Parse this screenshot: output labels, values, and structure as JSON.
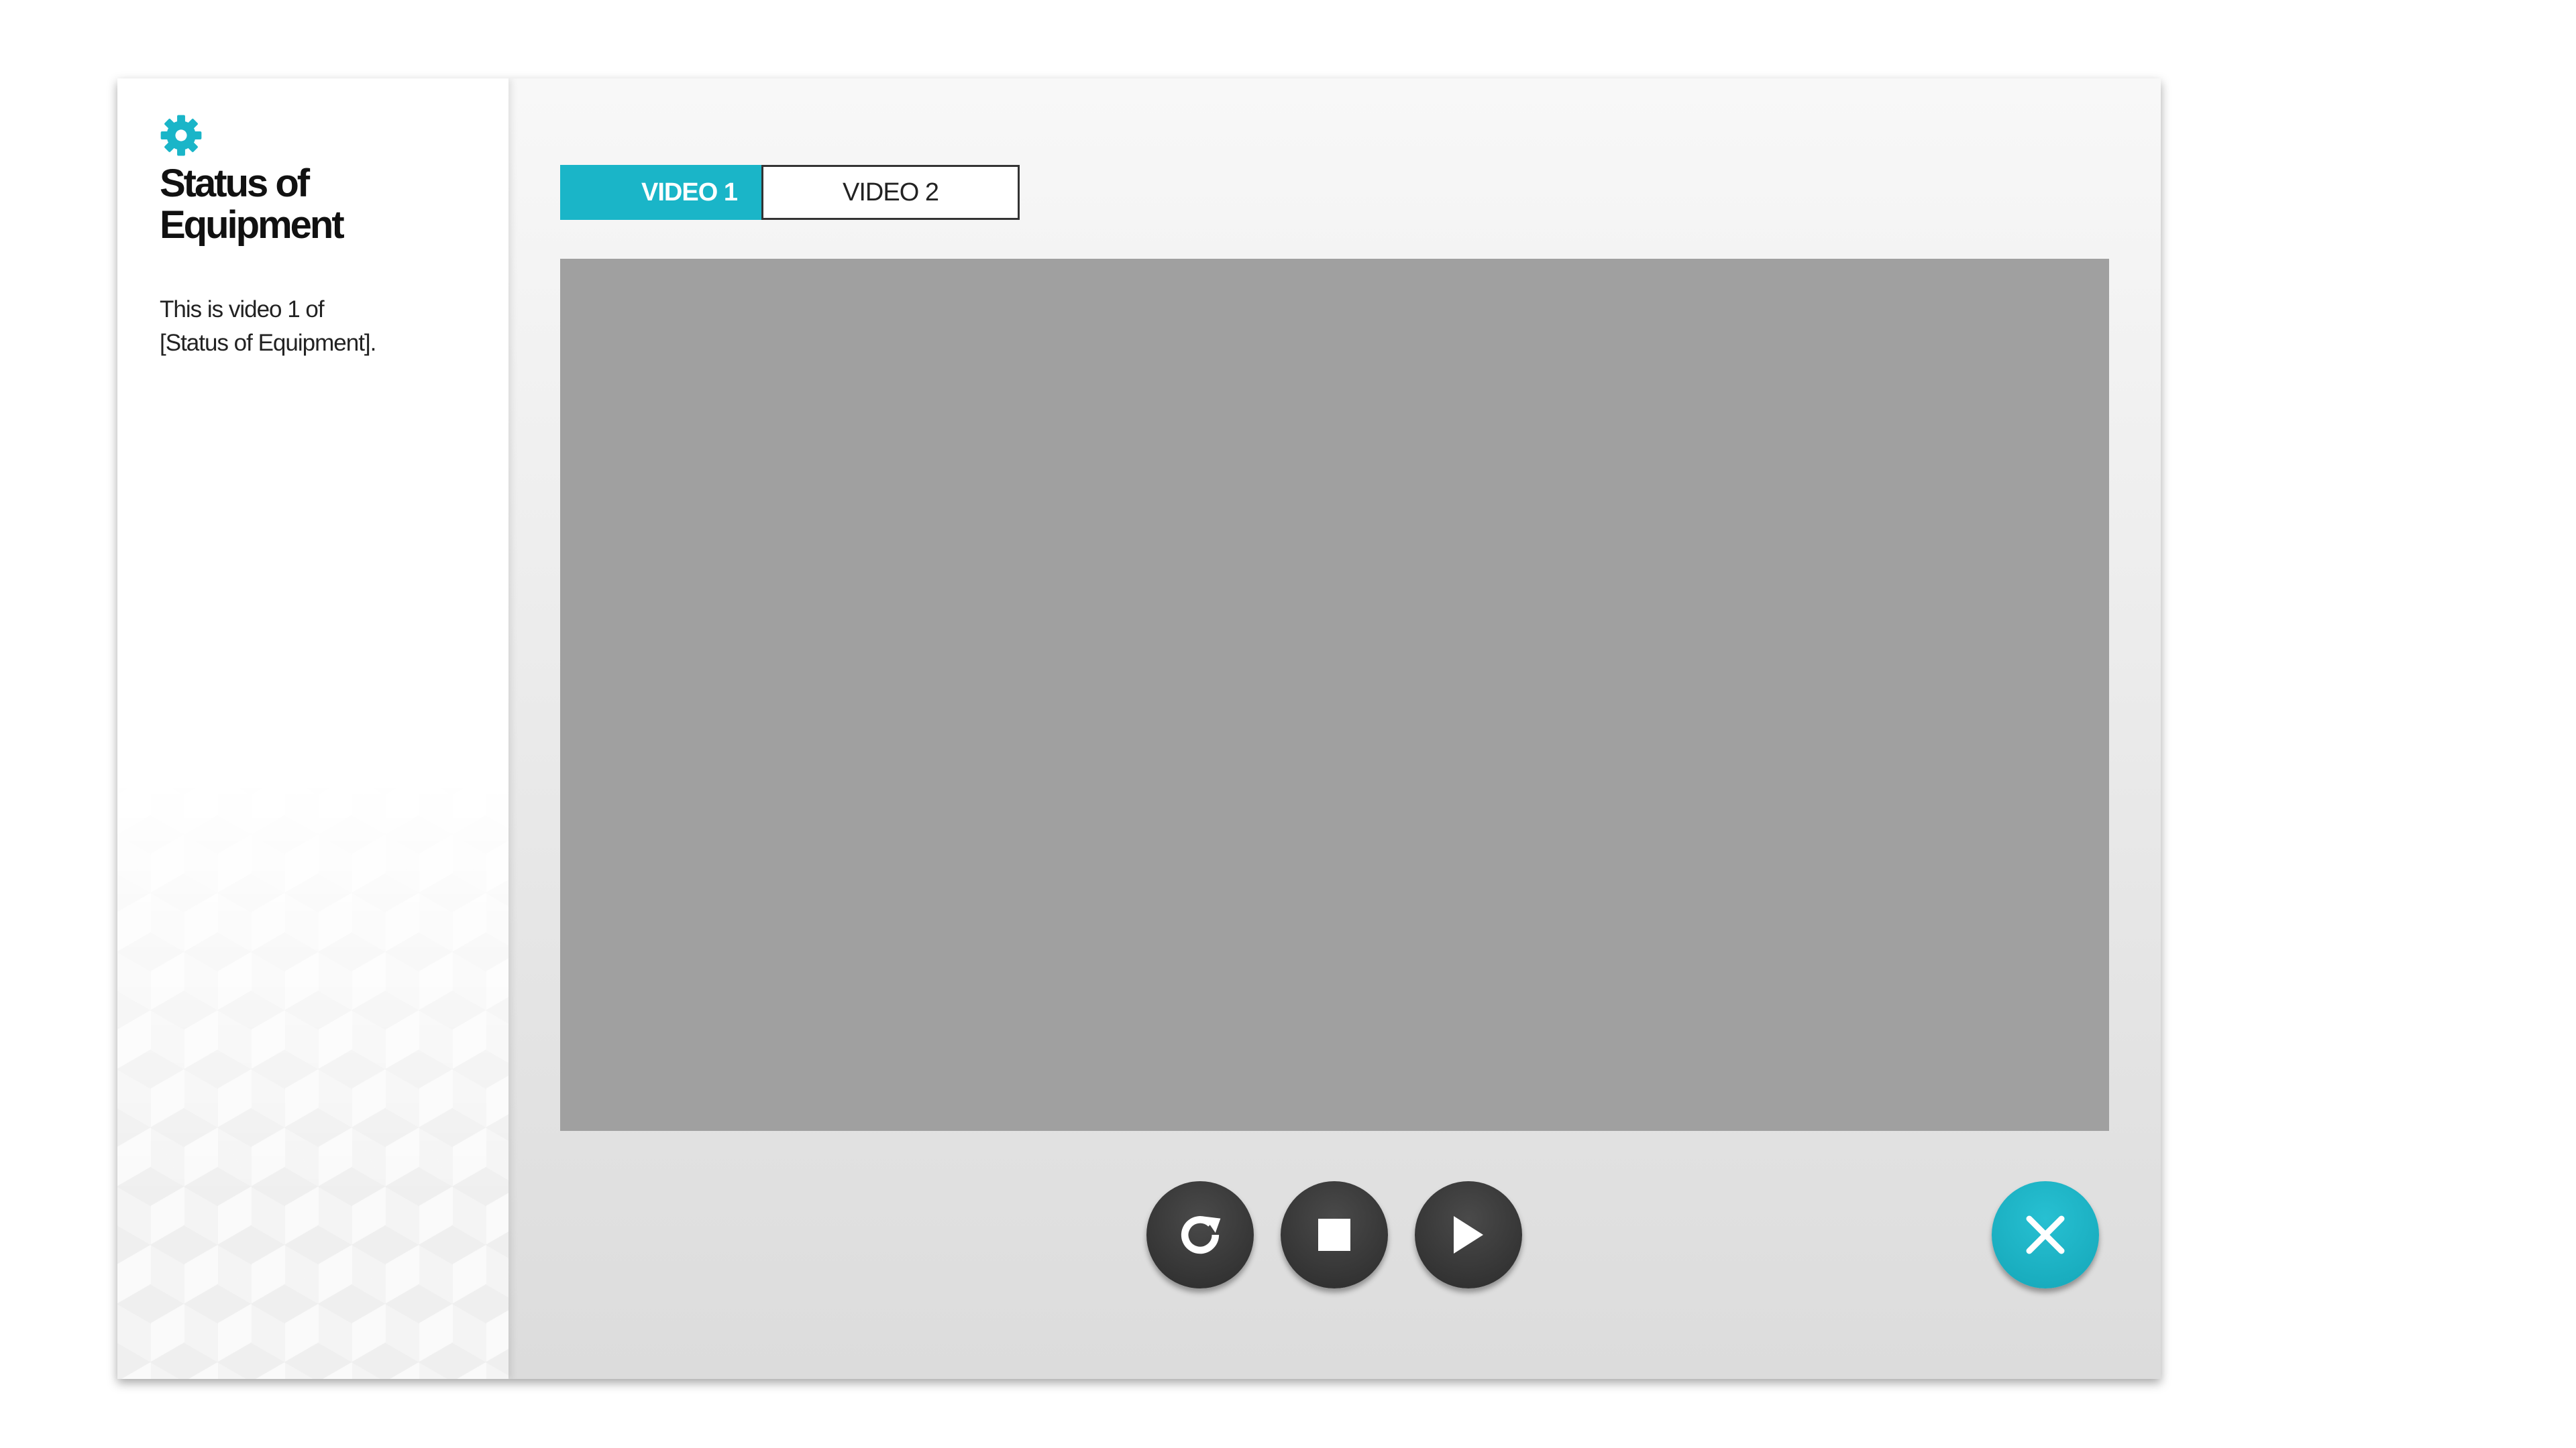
{
  "colors": {
    "accent": "#1ab5c8",
    "video_placeholder": "#a0a0a0",
    "control_button": "#333333"
  },
  "sidebar": {
    "icon": "gear-icon",
    "title_line1": "Status of",
    "title_line2": "Equipment",
    "description_line1": "This is video 1 of",
    "description_line2": "[Status of Equipment]."
  },
  "tabs": [
    {
      "label": "VIDEO 1",
      "active": true
    },
    {
      "label": "VIDEO 2",
      "active": false
    }
  ],
  "controls": {
    "replay_icon": "replay-icon",
    "stop_icon": "stop-icon",
    "play_icon": "play-icon",
    "close_icon": "close-icon"
  }
}
